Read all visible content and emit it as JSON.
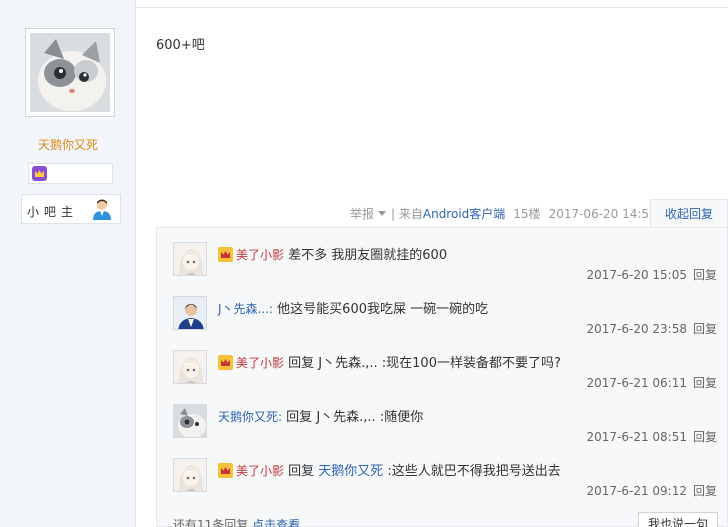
{
  "author": {
    "username": "天鹅你又死",
    "role": "小吧主"
  },
  "post": {
    "content": "600+吧",
    "report_label": "举报",
    "source_prefix": "| 来自",
    "source_client": "Android客户端",
    "floor": "15楼",
    "time": "2017-06-20 14:55",
    "collapse_label": "收起回复"
  },
  "replies": [
    {
      "user": "美了小影",
      "vip": true,
      "name_color": "red",
      "prefix": "",
      "target": "",
      "text": "差不多 我朋友圈就挂的600",
      "time": "2017-6-20 15:05",
      "reply_label": "回复",
      "avatar": "anime-girl-avatar"
    },
    {
      "user": "J丶先森...:",
      "vip": false,
      "name_color": "blue",
      "prefix": "",
      "target": "",
      "text": "他这号能买600我吃屎 一碗一碗的吃",
      "time": "2017-6-20 23:58",
      "reply_label": "回复",
      "avatar": "man-suit-avatar"
    },
    {
      "user": "美了小影",
      "vip": true,
      "name_color": "red",
      "prefix": "回复 ",
      "target": "",
      "text": "J丶先森.,.. :现在100一样装备都不要了吗?",
      "time": "2017-6-21 06:11",
      "reply_label": "回复",
      "avatar": "anime-girl-avatar"
    },
    {
      "user": "天鹅你又死:",
      "vip": false,
      "name_color": "blue",
      "prefix": "回复 ",
      "target": "",
      "text": "J丶先森.,.. :随便你",
      "time": "2017-6-21 08:51",
      "reply_label": "回复",
      "avatar": "cat-avatar"
    },
    {
      "user": "美了小影",
      "vip": true,
      "name_color": "red",
      "prefix": "回复 ",
      "target": "天鹅你又死",
      "text": " :这些人就巴不得我把号送出去",
      "time": "2017-6-21 09:12",
      "reply_label": "回复",
      "avatar": "anime-girl-avatar"
    }
  ],
  "more": {
    "prefix": "还有11条回复,",
    "link": "点击查看",
    "say_button": "我也说一句"
  },
  "colors": {
    "username_orange": "#e08a1a",
    "link_blue": "#2d64b3",
    "vip_red": "#c4363a",
    "left_bg": "#f2f6fb",
    "reply_bg": "#f7f8fa"
  }
}
